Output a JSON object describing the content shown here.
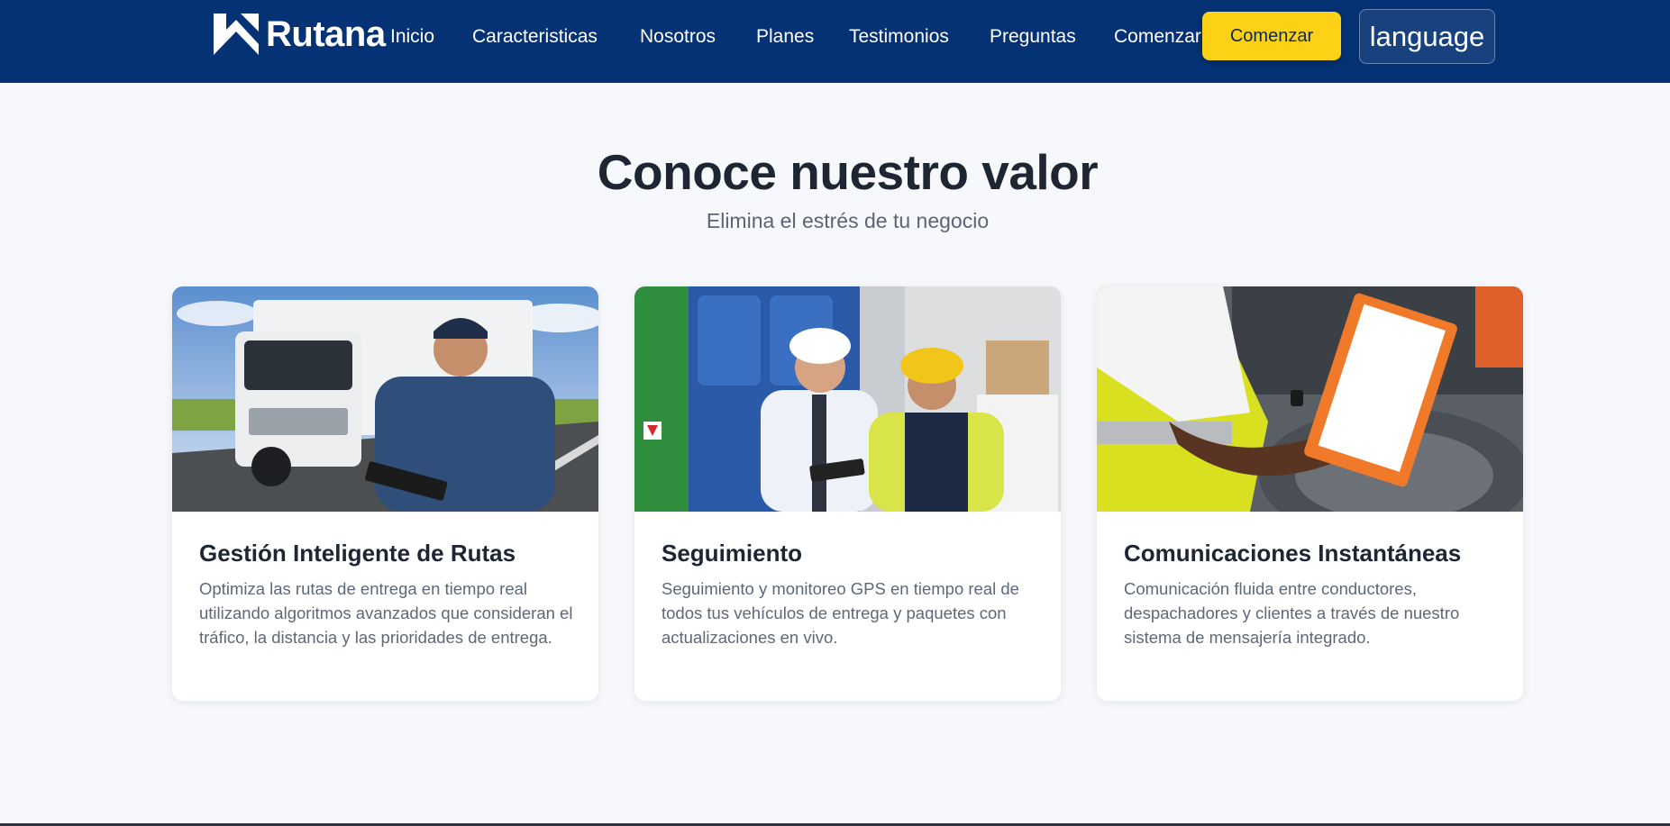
{
  "brand": {
    "name": "Rutana",
    "logo_icon": "chevron-up-arrow-logo",
    "color_primary": "#043275",
    "color_accent": "#fcd116"
  },
  "nav": {
    "links": [
      "Inicio",
      "Caracteristicas",
      "Nosotros",
      "Planes",
      "Testimonios",
      "Preguntas",
      "Comenzar"
    ],
    "cta_label": "Comenzar",
    "language_label": "language"
  },
  "section": {
    "title": "Conoce nuestro valor",
    "subtitle": "Elimina el estrés de tu negocio"
  },
  "cards": [
    {
      "image": "truck-driver-with-clipboard-photo",
      "title": "Gestión Inteligente de Rutas",
      "text": "Optimiza las rutas de entrega en tiempo real utilizando algoritmos avanzados que consideran el tráfico, la distancia y las prioridades de entrega."
    },
    {
      "image": "warehouse-workers-with-tablet-photo",
      "title": "Seguimiento",
      "text": "Seguimiento y monitoreo GPS en tiempo real de todos tus vehículos de entrega y paquetes con actualizaciones en vivo."
    },
    {
      "image": "worker-writing-on-clipboard-photo",
      "title": "Comunicaciones Instantáneas",
      "text": "Comunicación fluida entre conductores, despachadores y clientes a través de nuestro sistema de mensajería integrado."
    }
  ]
}
